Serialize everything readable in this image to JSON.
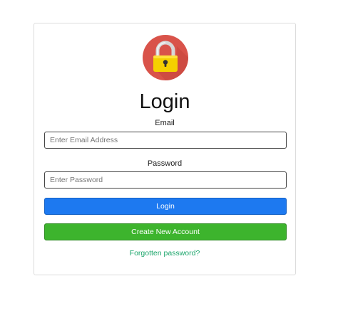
{
  "icon": "lock-icon",
  "colors": {
    "lock_background": "#d9534a",
    "lock_body": "#f5d000",
    "login_button": "#1d79f0",
    "create_button": "#3db42d",
    "forgot_link": "#1aa56a"
  },
  "title": "Login",
  "email": {
    "label": "Email",
    "placeholder": "Enter Email Address",
    "value": ""
  },
  "password": {
    "label": "Password",
    "placeholder": "Enter Password",
    "value": ""
  },
  "buttons": {
    "login": "Login",
    "create_account": "Create New Account"
  },
  "forgot_link": "Forgotten password?"
}
